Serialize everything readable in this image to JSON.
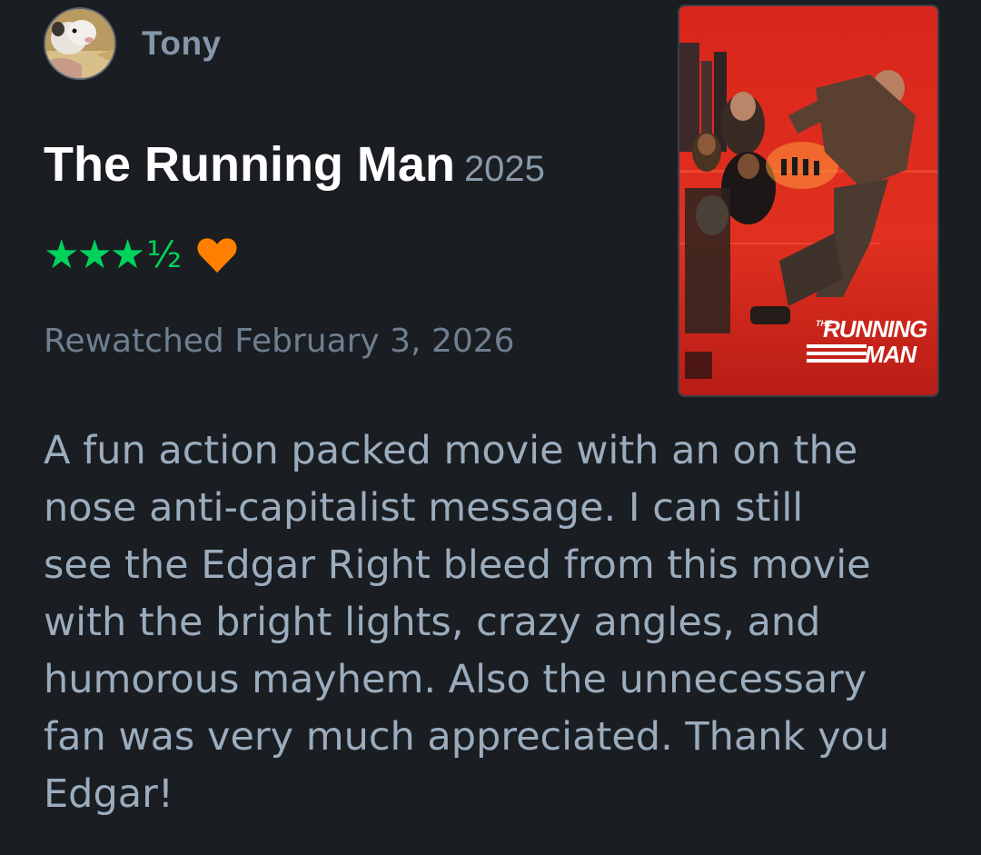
{
  "reviewer": {
    "name": "Tony",
    "avatar_icon": "avatar-photo"
  },
  "film": {
    "title": "The Running Man",
    "year": "2025",
    "poster_title_small": "THE",
    "poster_title_line1": "RUNNING",
    "poster_title_line2": "MAN"
  },
  "rating": {
    "stars": "★★★",
    "half": "½",
    "value": 3.5,
    "max": 5,
    "liked": true,
    "star_color": "#00d35c",
    "heart_color": "#ff8000"
  },
  "meta": {
    "watch_line": "Rewatched February 3, 2026"
  },
  "review": {
    "lines": [
      "A fun action packed movie with an on the",
      "nose anti-capitalist message. I can still",
      "see the Edgar Right bleed from this movie",
      "with the bright lights, crazy angles, and",
      "humorous mayhem. Also the unnecessary",
      "fan was very much appreciated. Thank you",
      "Edgar!"
    ]
  },
  "colors": {
    "background": "#1a1d22",
    "title": "#ffffff",
    "body_text": "#9bacbd",
    "muted_text": "#6f7f90"
  }
}
